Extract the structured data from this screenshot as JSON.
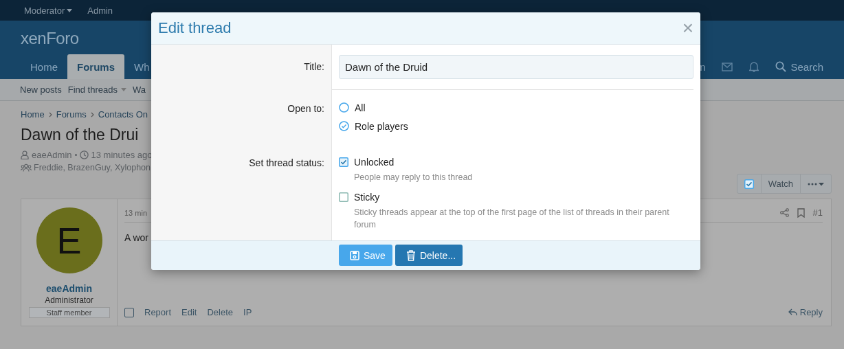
{
  "top_bar": {
    "items": [
      {
        "label": "Moderator",
        "dropdown": true
      },
      {
        "label": "Admin",
        "dropdown": false
      }
    ]
  },
  "logo": "xenForo",
  "nav": {
    "tabs": [
      {
        "label": "Home",
        "selected": false
      },
      {
        "label": "Forums",
        "selected": true
      },
      {
        "label": "Wh",
        "selected": false
      }
    ],
    "right_label": "n",
    "search": "Search"
  },
  "sub_nav": [
    {
      "label": "New posts",
      "dropdown": false
    },
    {
      "label": "Find threads",
      "dropdown": true
    },
    {
      "label": "Wa",
      "dropdown": false
    }
  ],
  "breadcrumb": [
    "Home",
    "Forums",
    "Contacts On"
  ],
  "thread": {
    "title": "Dawn of the Drui",
    "author": "eaeAdmin",
    "time": "13 minutes ago",
    "participants": "Freddie, BrazenGuy, Xylophon"
  },
  "thread_actions": {
    "watch": "Watch",
    "selected": true
  },
  "post": {
    "avatar_letter": "E",
    "username": "eaeAdmin",
    "role": "Administrator",
    "banner": "Staff member",
    "time": "13 min",
    "body": "A wor",
    "number": "#1",
    "actions": [
      "Report",
      "Edit",
      "Delete",
      "IP"
    ],
    "reply": "Reply",
    "selected": false
  },
  "modal": {
    "title": "Edit thread",
    "close": "×",
    "title_field": {
      "label": "Title:",
      "value": "Dawn of the Druid"
    },
    "open_to": {
      "label": "Open to:",
      "options": [
        {
          "label": "All",
          "selected": false
        },
        {
          "label": "Role players",
          "selected": true
        }
      ]
    },
    "status": {
      "label": "Set thread status:",
      "options": [
        {
          "label": "Unlocked",
          "hint": "People may reply to this thread",
          "checked": true
        },
        {
          "label": "Sticky",
          "hint": "Sticky threads appear at the top of the first page of the list of threads in their parent forum",
          "checked": false
        }
      ]
    },
    "buttons": [
      {
        "label": "Save",
        "kind": "save"
      },
      {
        "label": "Delete...",
        "kind": "delete"
      }
    ]
  }
}
